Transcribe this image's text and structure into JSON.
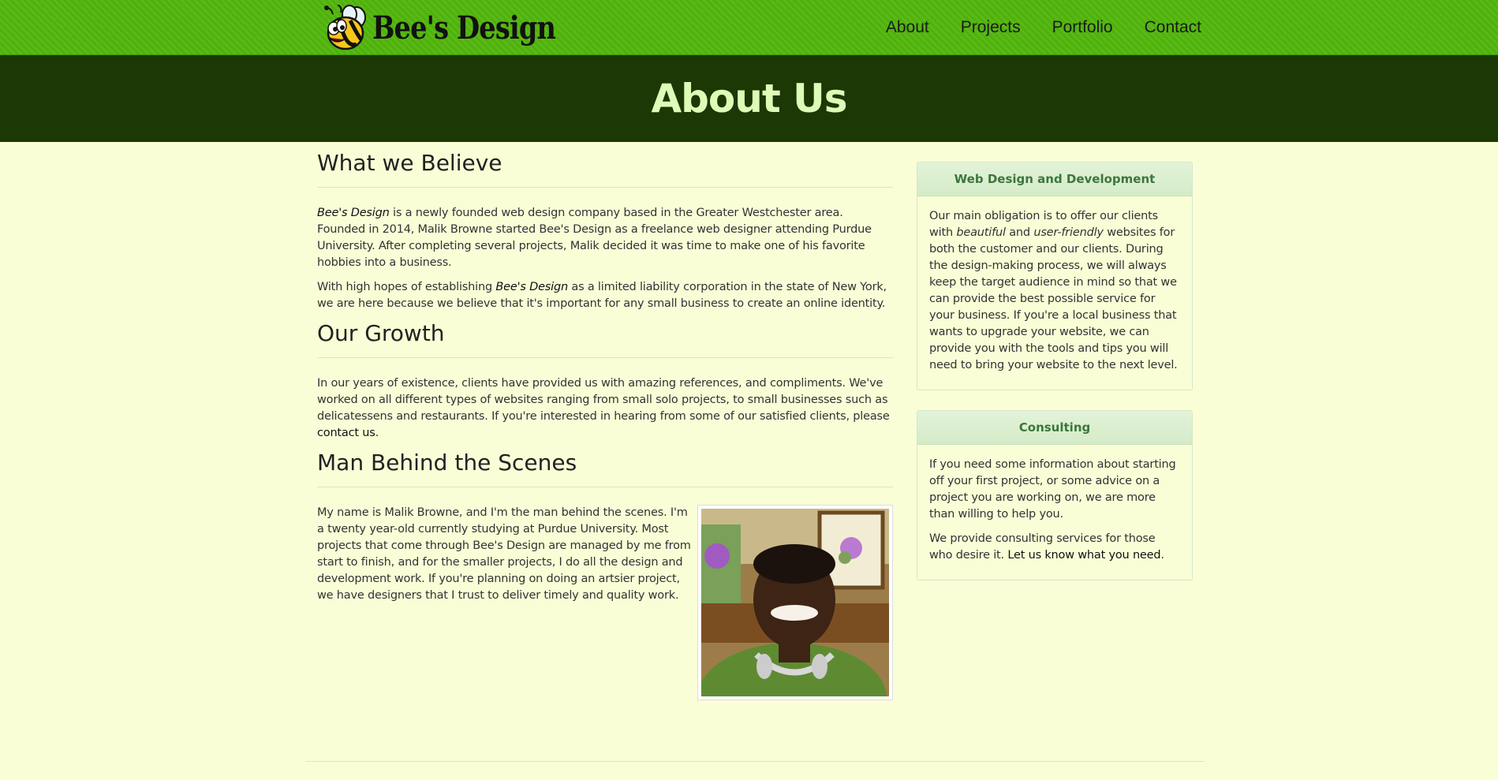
{
  "brand": {
    "name": "Bee's Design",
    "logo_icon": "bee-icon"
  },
  "nav": {
    "items": [
      {
        "label": "About"
      },
      {
        "label": "Projects"
      },
      {
        "label": "Portfolio"
      },
      {
        "label": "Contact"
      }
    ]
  },
  "header": {
    "title": "About Us"
  },
  "main": {
    "believe": {
      "heading": "What we Believe",
      "p1_em": "Bee's Design",
      "p1_rest": " is a newly founded web design company based in the Greater Westchester area. Founded in 2014, Malik Browne started Bee's Design as a freelance web designer attending Purdue University. After completing several projects, Malik decided it was time to make one of his favorite hobbies into a business.",
      "p2_start": "With high hopes of establishing ",
      "p2_em": "Bee's Design",
      "p2_rest": " as a limited liability corporation in the state of New York, we are here because we believe that it's important for any small business to create an online identity."
    },
    "growth": {
      "heading": "Our Growth",
      "p1": "In our years of existence, clients have provided us with amazing references, and compliments. We've worked on all different types of websites ranging from small solo projects, to small businesses such as delicatessens and restaurants. If you're interested in hearing from some of our satisfied clients, please ",
      "link": "contact us",
      "p1_end": "."
    },
    "man": {
      "heading": "Man Behind the Scenes",
      "p1": "My name is Malik Browne, and I'm the man behind the scenes. I'm a twenty year-old currently studying at Purdue University. Most projects that come through Bee's Design are managed by me from start to finish, and for the smaller projects, I do all the design and development work. If you're planning on doing an artsier project, we have designers that I trust to deliver timely and quality work."
    }
  },
  "sidebar": {
    "web": {
      "title": "Web Design and Development",
      "p_start": "Our main obligation is to offer our clients with ",
      "em1": "beautiful",
      "and": " and ",
      "em2": "user-friendly",
      "p_rest": " websites for both the customer and our clients. During the design-making process, we will always keep the target audience in mind so that we can provide the best possible service for your business. If you're a local business that wants to upgrade your website, we can provide you with the tools and tips you will need to bring your website to the next level."
    },
    "consulting": {
      "title": "Consulting",
      "p1": "If you need some information about starting off your first project, or some advice on a project you are working on, we are more than willing to help you.",
      "p2_start": "We provide consulting services for those who desire it. ",
      "link": "Let us know what you need",
      "p2_end": "."
    }
  },
  "colors": {
    "navbar": "#52b60c",
    "header": "#1c3804",
    "background": "#fafed7",
    "title": "#dffbb8",
    "panel_title": "#3c763d"
  }
}
